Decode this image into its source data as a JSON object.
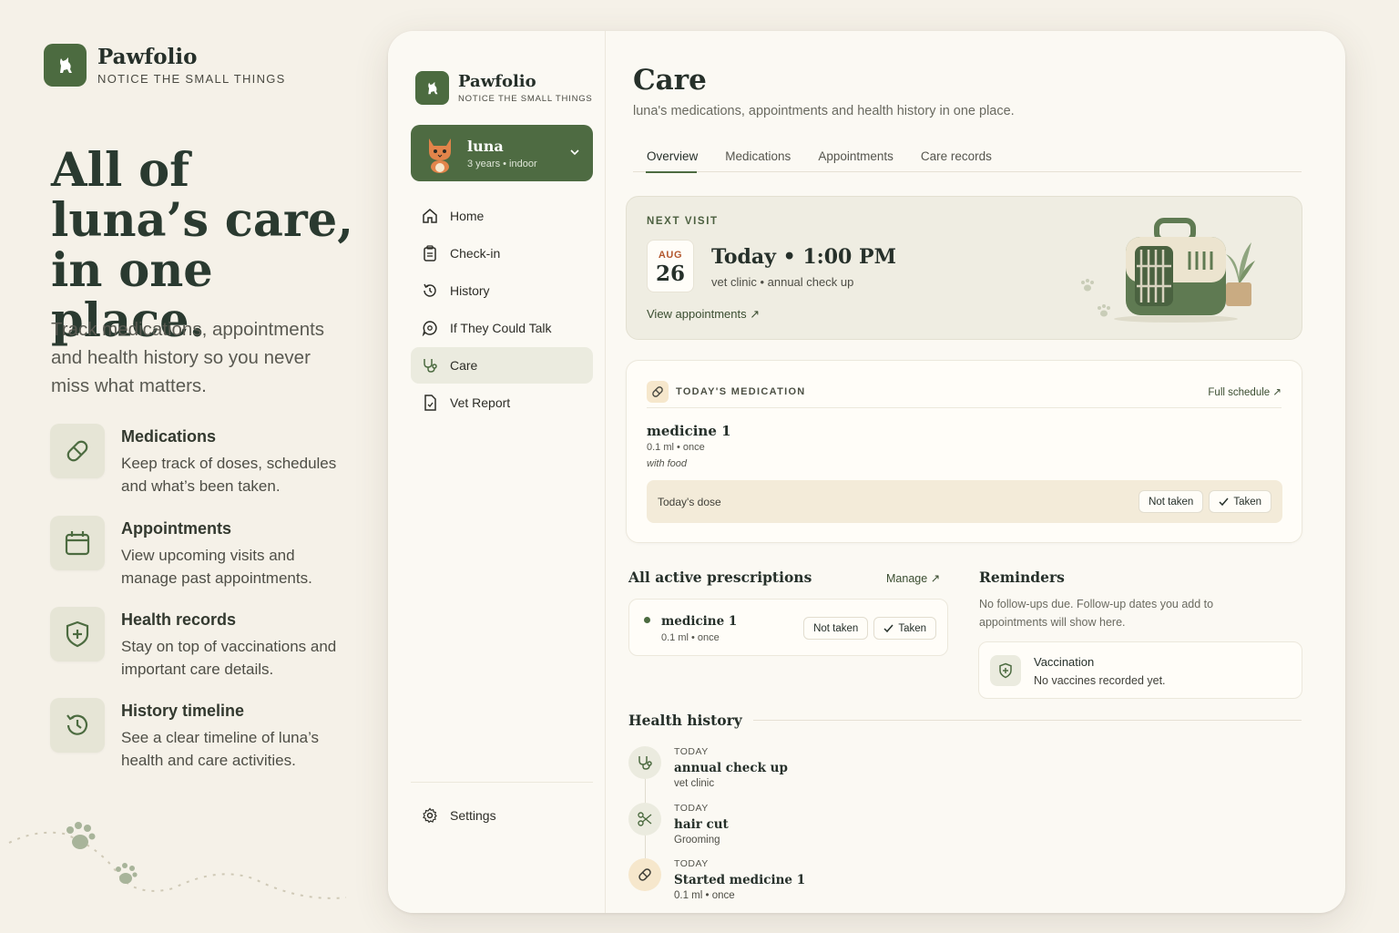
{
  "brand": {
    "name": "Pawfolio",
    "tagline": "NOTICE THE SMALL THINGS",
    "logo_icon": "cat-silhouette-icon"
  },
  "hero": {
    "title": "All of luna’s care, in one place.",
    "subtitle": "Track medications, appointments and health history so you never miss what matters."
  },
  "features": [
    {
      "icon": "pill-icon",
      "title": "Medications",
      "desc": "Keep track of doses, schedules and what’s been taken."
    },
    {
      "icon": "calendar-icon",
      "title": "Appointments",
      "desc": "View upcoming visits and manage past appointments."
    },
    {
      "icon": "shield-plus-icon",
      "title": "Health records",
      "desc": "Stay on top of vaccinations and important care details."
    },
    {
      "icon": "history-icon",
      "title": "History timeline",
      "desc": "See a clear timeline of luna’s health and care activities."
    }
  ],
  "sidebar": {
    "brand_name": "Pawfolio",
    "brand_tag": "NOTICE THE SMALL THINGS",
    "pet": {
      "name": "luna",
      "meta": "3 years • indoor"
    },
    "nav": [
      {
        "label": "Home",
        "icon": "home-icon"
      },
      {
        "label": "Check-in",
        "icon": "clipboard-icon"
      },
      {
        "label": "History",
        "icon": "history-icon"
      },
      {
        "label": "If They Could Talk",
        "icon": "chat-icon"
      },
      {
        "label": "Care",
        "icon": "stethoscope-icon",
        "active": true
      },
      {
        "label": "Vet Report",
        "icon": "report-icon"
      }
    ],
    "settings_label": "Settings"
  },
  "main": {
    "title": "Care",
    "subtitle": "luna's medications, appointments and health history in one place.",
    "tabs": [
      "Overview",
      "Medications",
      "Appointments",
      "Care records"
    ],
    "active_tab": "Overview",
    "next_visit": {
      "eyebrow": "NEXT VISIT",
      "month": "AUG",
      "day": "26",
      "time": "Today • 1:00 PM",
      "place": "vet clinic • annual check up",
      "link": "View appointments ↗"
    },
    "todays_medication": {
      "eyebrow": "TODAY'S MEDICATION",
      "full_schedule": "Full schedule ↗",
      "name": "medicine 1",
      "dose": "0.1 ml • once",
      "note": "with food",
      "dose_label": "Today's dose",
      "not_taken": "Not taken",
      "taken": "Taken"
    },
    "prescriptions": {
      "title": "All active prescriptions",
      "manage": "Manage ↗",
      "items": [
        {
          "name": "medicine 1",
          "dose": "0.1 ml • once",
          "not_taken": "Not taken",
          "taken": "Taken"
        }
      ]
    },
    "reminders": {
      "title": "Reminders",
      "text": "No follow-ups due. Follow-up dates you add to appointments will show here.",
      "vaccination_title": "Vaccination",
      "vaccination_text": "No vaccines recorded yet."
    },
    "health_history": {
      "title": "Health history",
      "items": [
        {
          "when": "TODAY",
          "name": "annual check up",
          "detail": "vet clinic",
          "icon": "stethoscope-icon"
        },
        {
          "when": "TODAY",
          "name": "hair cut",
          "detail": "Grooming",
          "icon": "scissors-icon"
        },
        {
          "when": "TODAY",
          "name": "Started medicine 1",
          "detail": "0.1 ml • once",
          "icon": "pill-icon"
        }
      ]
    }
  },
  "colors": {
    "accent": "#4c6b40",
    "background": "#f5f1e8",
    "card": "#fffdf8",
    "warm": "#f3ebd9"
  }
}
